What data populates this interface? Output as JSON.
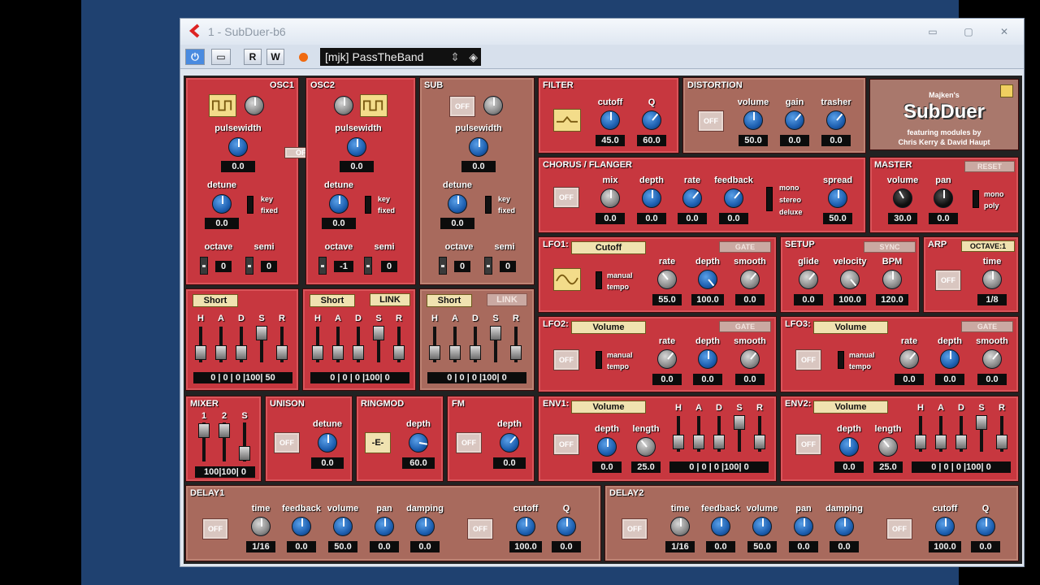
{
  "window": {
    "title": "1 - SubDuer-b6",
    "preset": "[mjk] PassTheBand",
    "btn_r": "R",
    "btn_w": "W"
  },
  "logo": {
    "small": "Majken's",
    "name": "SubDuer",
    "featuring": "featuring modules by",
    "authors": "Chris Kerry & David Haupt"
  },
  "osc1": {
    "title": "OSC1",
    "pw_label": "pulsewidth",
    "pw": "0.0",
    "detune_label": "detune",
    "detune": "0.0",
    "key": "key",
    "fixed": "fixed",
    "octave_label": "octave",
    "semi_label": "semi",
    "octave": "0",
    "semi": "0",
    "off": "OFF"
  },
  "osc2": {
    "title": "OSC2",
    "pw_label": "pulsewidth",
    "pw": "0.0",
    "detune_label": "detune",
    "detune": "0.0",
    "key": "key",
    "fixed": "fixed",
    "octave_label": "octave",
    "semi_label": "semi",
    "octave": "-1",
    "semi": "0"
  },
  "sub": {
    "title": "SUB",
    "off": "OFF",
    "pw_label": "pulsewidth",
    "pw": "0.0",
    "detune_label": "detune",
    "detune": "0.0",
    "key": "key",
    "fixed": "fixed",
    "octave_label": "octave",
    "semi_label": "semi",
    "octave": "0",
    "semi": "0"
  },
  "env_a": {
    "mode": "Short",
    "hadsr": [
      "H",
      "A",
      "D",
      "S",
      "R"
    ],
    "values": "0 | 0 | 0 |100| 50"
  },
  "env_b": {
    "mode": "Short",
    "link": "LINK",
    "hadsr": [
      "H",
      "A",
      "D",
      "S",
      "R"
    ],
    "values": "0 | 0 | 0 |100| 0"
  },
  "env_c": {
    "mode": "Short",
    "link": "LINK",
    "hadsr": [
      "H",
      "A",
      "D",
      "S",
      "R"
    ],
    "values": "0 | 0 | 0 |100| 0"
  },
  "filter": {
    "title": "FILTER",
    "cutoff_label": "cutoff",
    "q_label": "Q",
    "cutoff": "45.0",
    "q": "60.0"
  },
  "distortion": {
    "title": "DISTORTION",
    "off": "OFF",
    "volume_label": "volume",
    "gain_label": "gain",
    "trasher_label": "trasher",
    "volume": "50.0",
    "gain": "0.0",
    "trasher": "0.0"
  },
  "chorus": {
    "title": "CHORUS / FLANGER",
    "off": "OFF",
    "mix_label": "mix",
    "depth_label": "depth",
    "rate_label": "rate",
    "feedback_label": "feedback",
    "mono": "mono",
    "stereo": "stereo",
    "deluxe": "deluxe",
    "spread_label": "spread",
    "mix": "0.0",
    "depth": "0.0",
    "rate": "0.0",
    "feedback": "0.0",
    "spread": "50.0"
  },
  "master": {
    "title": "MASTER",
    "reset": "RESET",
    "volume_label": "volume",
    "pan_label": "pan",
    "mono": "mono",
    "poly": "poly",
    "volume": "30.0",
    "pan": "0.0"
  },
  "lfo1": {
    "title": "LFO1:",
    "target": "Cutoff",
    "gate": "GATE",
    "manual": "manual",
    "tempo": "tempo",
    "rate_label": "rate",
    "depth_label": "depth",
    "smooth_label": "smooth",
    "rate": "55.0",
    "depth": "100.0",
    "smooth": "0.0"
  },
  "setup": {
    "title": "SETUP",
    "sync": "SYNC",
    "glide_label": "glide",
    "velocity_label": "velocity",
    "bpm_label": "BPM",
    "glide": "0.0",
    "velocity": "100.0",
    "bpm": "120.0"
  },
  "arp": {
    "title": "ARP",
    "octave": "OCTAVE:1",
    "off": "OFF",
    "time_label": "time",
    "time": "1/8"
  },
  "lfo2": {
    "title": "LFO2:",
    "target": "Volume",
    "gate": "GATE",
    "off": "OFF",
    "manual": "manual",
    "tempo": "tempo",
    "rate_label": "rate",
    "depth_label": "depth",
    "smooth_label": "smooth",
    "rate": "0.0",
    "depth": "0.0",
    "smooth": "0.0"
  },
  "lfo3": {
    "title": "LFO3:",
    "target": "Volume",
    "gate": "GATE",
    "off": "OFF",
    "manual": "manual",
    "tempo": "tempo",
    "rate_label": "rate",
    "depth_label": "depth",
    "smooth_label": "smooth",
    "rate": "0.0",
    "depth": "0.0",
    "smooth": "0.0"
  },
  "mixer": {
    "title": "MIXER",
    "ch": [
      "1",
      "2",
      "S"
    ],
    "values": "100|100| 0"
  },
  "unison": {
    "title": "UNISON",
    "off": "OFF",
    "detune_label": "detune",
    "detune": "0.0"
  },
  "ringmod": {
    "title": "RINGMOD",
    "e": "-E-",
    "depth_label": "depth",
    "depth": "60.0"
  },
  "fm": {
    "title": "FM",
    "off": "OFF",
    "depth_label": "depth",
    "depth": "0.0"
  },
  "env1": {
    "title": "ENV1:",
    "target": "Volume",
    "off": "OFF",
    "depth_label": "depth",
    "length_label": "length",
    "depth": "0.0",
    "length": "25.0",
    "hadsr": [
      "H",
      "A",
      "D",
      "S",
      "R"
    ],
    "values": "0 | 0 | 0 |100| 0"
  },
  "env2": {
    "title": "ENV2:",
    "target": "Volume",
    "off": "OFF",
    "depth_label": "depth",
    "length_label": "length",
    "depth": "0.0",
    "length": "25.0",
    "hadsr": [
      "H",
      "A",
      "D",
      "S",
      "R"
    ],
    "values": "0 | 0 | 0 |100| 0"
  },
  "delay1": {
    "title": "DELAY1",
    "off": "OFF",
    "off2": "OFF",
    "time_label": "time",
    "feedback_label": "feedback",
    "volume_label": "volume",
    "pan_label": "pan",
    "damping_label": "damping",
    "cutoff_label": "cutoff",
    "q_label": "Q",
    "time": "1/16",
    "feedback": "0.0",
    "volume": "50.0",
    "pan": "0.0",
    "damping": "0.0",
    "cutoff": "100.0",
    "q": "0.0"
  },
  "delay2": {
    "title": "DELAY2",
    "off": "OFF",
    "off2": "OFF",
    "time_label": "time",
    "feedback_label": "feedback",
    "volume_label": "volume",
    "pan_label": "pan",
    "damping_label": "damping",
    "cutoff_label": "cutoff",
    "q_label": "Q",
    "time": "1/16",
    "feedback": "0.0",
    "volume": "50.0",
    "pan": "0.0",
    "damping": "0.0",
    "cutoff": "100.0",
    "q": "0.0"
  }
}
